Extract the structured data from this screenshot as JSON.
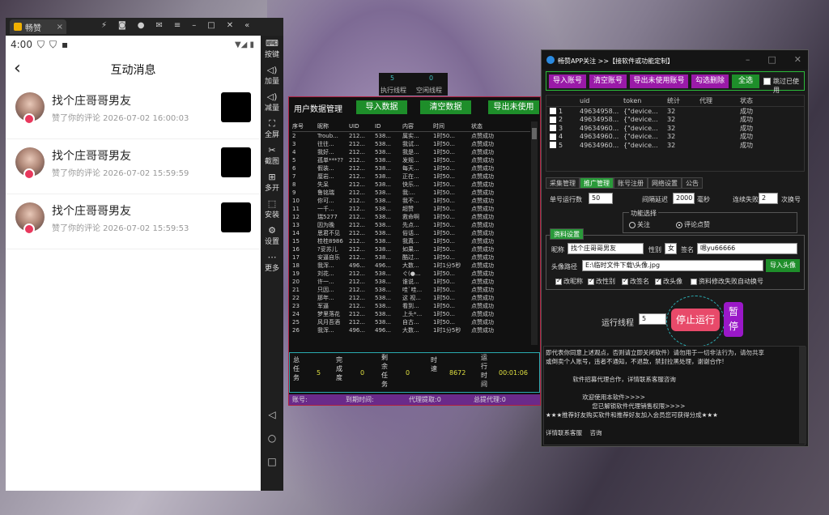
{
  "emulator": {
    "tab_title": "畅赞",
    "sidebar": [
      {
        "icon": "keyboard-icon",
        "label": "按键"
      },
      {
        "icon": "volume-up-icon",
        "label": "加量"
      },
      {
        "icon": "volume-down-icon",
        "label": "减量"
      },
      {
        "icon": "fullscreen-icon",
        "label": "全屏"
      },
      {
        "icon": "scissors-icon",
        "label": "截图"
      },
      {
        "icon": "multi-window-icon",
        "label": "多开"
      },
      {
        "icon": "apk-icon",
        "label": "安装"
      },
      {
        "icon": "gear-icon",
        "label": "设置"
      },
      {
        "icon": "more-icon",
        "label": "更多"
      }
    ]
  },
  "phone": {
    "time": "4:00",
    "title": "互动消息",
    "messages": [
      {
        "name": "找个庄哥哥男友",
        "sub": "赞了你的评论 2026-07-02 16:00:03"
      },
      {
        "name": "找个庄哥哥男友",
        "sub": "赞了你的评论 2026-07-02 15:59:59"
      },
      {
        "name": "找个庄哥哥男友",
        "sub": "赞了你的评论 2026-07-02 15:59:53"
      }
    ]
  },
  "threads": {
    "exec_label": "执行线程",
    "exec_value": "5",
    "idle_label": "空闲线程",
    "idle_value": "0"
  },
  "middle": {
    "title": "用户数据管理",
    "import_btn": "导入数据",
    "clear_btn": "清空数据",
    "export_btn": "导出未使用",
    "headers": [
      "序号",
      "昵称",
      "UID",
      "ID",
      "内容",
      "时间",
      "状态"
    ],
    "rows": [
      [
        "2",
        "Troub...",
        "212...",
        "538...",
        "属实...",
        "1时50...",
        "点赞成功"
      ],
      [
        "3",
        "往往...",
        "212...",
        "538...",
        "我试...",
        "1时50...",
        "点赞成功"
      ],
      [
        "4",
        "我好...",
        "212...",
        "538...",
        "我是...",
        "1时50...",
        "点赞成功"
      ],
      [
        "5",
        "孤单***??",
        "212...",
        "538...",
        "发规...",
        "1时50...",
        "点赞成功"
      ],
      [
        "6",
        "假装...",
        "212...",
        "538...",
        "每天...",
        "1时50...",
        "点赞成功"
      ],
      [
        "7",
        "厘岩...",
        "212...",
        "538...",
        "正在...",
        "1时50...",
        "点赞成功"
      ],
      [
        "8",
        "失呆",
        "212...",
        "538...",
        "快乐...",
        "1时50...",
        "点赞成功"
      ],
      [
        "9",
        "鲁铭瑞",
        "212...",
        "538...",
        "我:...",
        "1时50...",
        "点赞成功"
      ],
      [
        "10",
        "你可...",
        "212...",
        "538...",
        "我不...",
        "1时50...",
        "点赞成功"
      ],
      [
        "11",
        "一千...",
        "212...",
        "538...",
        "超赞",
        "1时50...",
        "点赞成功"
      ],
      [
        "12",
        "瑞5277",
        "212...",
        "538...",
        "救命啊",
        "1时50...",
        "点赞成功"
      ],
      [
        "13",
        "因为晚",
        "212...",
        "538...",
        "先点...",
        "1时50...",
        "点赞成功"
      ],
      [
        "14",
        "思君不见",
        "212...",
        "538...",
        "俗话...",
        "1时50...",
        "点赞成功"
      ],
      [
        "15",
        "桂桂8986",
        "212...",
        "538...",
        "我真...",
        "1时50...",
        "点赞成功"
      ],
      [
        "16",
        "?妥苏儿",
        "212...",
        "538...",
        "如果...",
        "1时50...",
        "点赞成功"
      ],
      [
        "17",
        "安逼自乐",
        "212...",
        "538...",
        "酷过...",
        "1时50...",
        "点赞成功"
      ],
      [
        "18",
        "我浑...",
        "496...",
        "496...",
        "大数...",
        "1时1分5秒",
        "点赞成功"
      ],
      [
        "19",
        "刘花...",
        "212...",
        "538...",
        "ぐ(●...",
        "1时50...",
        "点赞成功"
      ],
      [
        "20",
        "许一...",
        "212...",
        "538...",
        "谁说...",
        "1时50...",
        "点赞成功"
      ],
      [
        "21",
        "只因...",
        "212...",
        "538...",
        "哇`哇...",
        "1时50...",
        "点赞成功"
      ],
      [
        "22",
        "那年...",
        "212...",
        "538...",
        "这 视...",
        "1时50...",
        "点赞成功"
      ],
      [
        "23",
        "军逼",
        "212...",
        "538...",
        "看到...",
        "1时50...",
        "点赞成功"
      ],
      [
        "24",
        "梦里落花",
        "212...",
        "538...",
        "上头*...",
        "1时50...",
        "点赞成功"
      ],
      [
        "25",
        "风月吾酒",
        "212...",
        "538...",
        "自古...",
        "1时50...",
        "点赞成功"
      ],
      [
        "26",
        "我浑...",
        "496...",
        "496...",
        "大数...",
        "1时1分5秒",
        "点赞成功"
      ]
    ],
    "stats": {
      "total_label": "总任务",
      "total": "5",
      "done_label": "完成度",
      "done": "0",
      "remain_label": "剩余任务",
      "remain": "0",
      "speed_label": "时速",
      "speed": "8672",
      "runtime_label": "运行时间",
      "runtime": "00:01:06"
    },
    "footer": {
      "account": "账号:",
      "expire": "到期时间:",
      "agent": "代理提取:0",
      "total": "总提代理:0"
    }
  },
  "right": {
    "title": "畅赞APP关注 >>【接软件或功能定制】",
    "toolbar": [
      "导入账号",
      "清空账号",
      "导出未使用账号",
      "勾选删除",
      "全选"
    ],
    "skip_used": "跳过已使用",
    "headers": [
      "uid",
      "token",
      "统计",
      "代理",
      "状态"
    ],
    "rows": [
      [
        "1",
        "49634958...",
        "{\"device...",
        "32",
        "",
        "成功"
      ],
      [
        "2",
        "49634958...",
        "{\"device...",
        "32",
        "",
        "成功"
      ],
      [
        "3",
        "49634960...",
        "{\"device...",
        "32",
        "",
        "成功"
      ],
      [
        "4",
        "49634960...",
        "{\"device...",
        "32",
        "",
        "成功"
      ],
      [
        "5",
        "49634960...",
        "{\"device...",
        "32",
        "",
        "成功"
      ]
    ],
    "tabs": [
      "采集管理",
      "推广管理",
      "账号注册",
      "网络设置",
      "公告"
    ],
    "single_run_label": "单号运行数",
    "single_run": "50",
    "interval_label": "间隔延迟",
    "interval": "2000",
    "ms": "毫秒",
    "fail_label": "连续失败",
    "fail": "2",
    "switch": "次换号",
    "func_title": "功能选择",
    "opt_follow": "关注",
    "opt_like": "评论点赞",
    "profile_tab": "资料设置",
    "nick_label": "昵称",
    "nick": "找个庄哥哥男友",
    "gender_label": "性别",
    "gender": "女",
    "sign_label": "签名",
    "sign": "嗯yu66666",
    "avatar_label": "头像路径",
    "avatar": "E:\\临时文件下载\\头像.jpg",
    "import_avatar": "导入头像",
    "checks": [
      "改昵称",
      "改性别",
      "改签名",
      "改头像",
      "资料修改失败自动换号"
    ],
    "threads_label": "运行线程",
    "threads": "5",
    "stop": "停止运行",
    "pause": "暂停",
    "log": [
      "即代表你同意上述观点，否则请立即关闭软件）请勿用于一切非法行为，请勿共享",
      "或倒卖个人账号，违者不通知，不退款，禁封拉黑处理，谢谢合作!",
      "",
      "              软件招募代理合作，详情联系客服咨询",
      "",
      "                   欢迎使用本软件>>>>",
      "                        您已解锁软件代理销售权限>>>>",
      "★★★推荐好友购买软件和推荐好友加入会员您可获得分成★★★",
      "",
      "详情联系客服    咨询"
    ]
  }
}
